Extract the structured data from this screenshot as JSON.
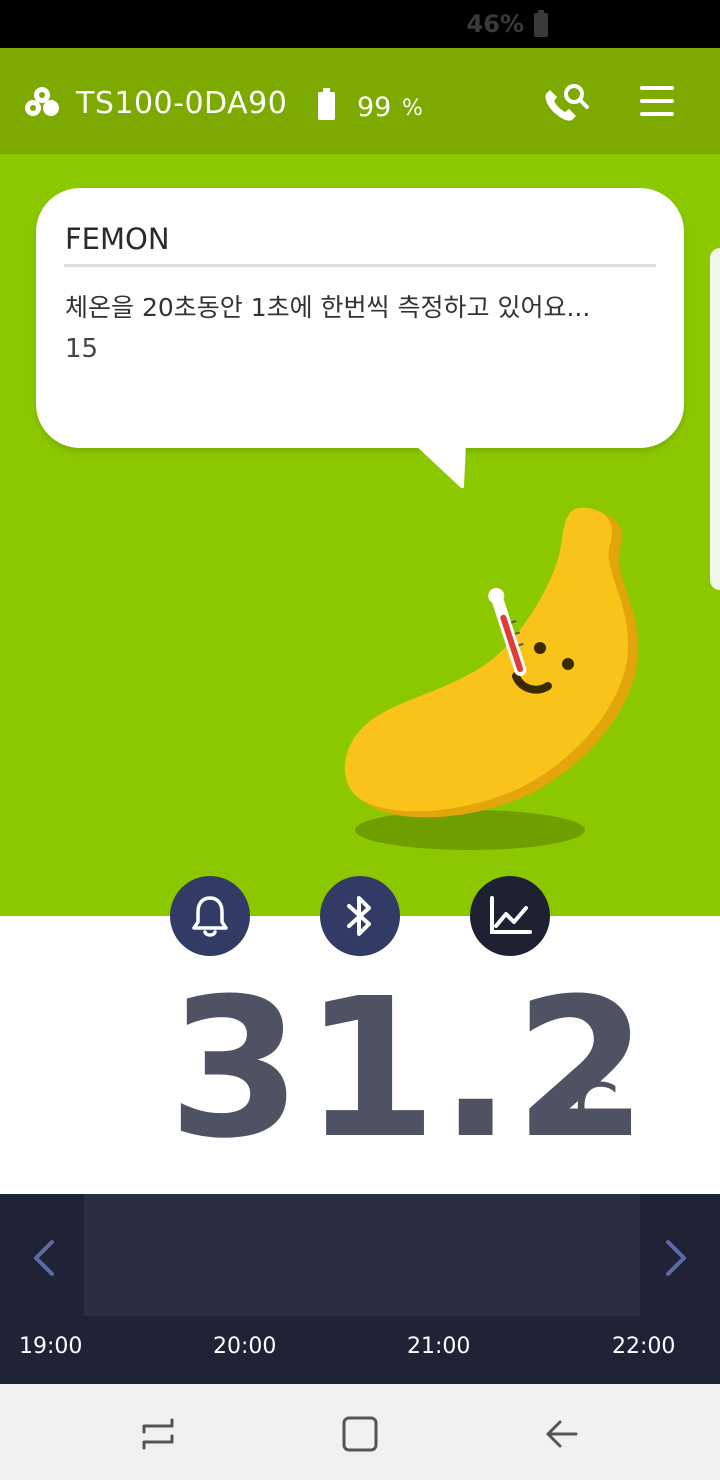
{
  "status_bar": {
    "battery_percent": "46%"
  },
  "header": {
    "device_name": "TS100-0DA90",
    "battery_value": "99",
    "battery_unit": "%",
    "icons": [
      "logo-icon",
      "battery-icon",
      "call-search-icon",
      "menu-icon"
    ]
  },
  "bubble": {
    "title": "FEMON",
    "message": "체온을 20초동안 1초에 한번씩 측정하고 있어요...",
    "count": "15"
  },
  "actions": {
    "icons": [
      "bell-icon",
      "bluetooth-icon",
      "chart-icon"
    ]
  },
  "temperature": {
    "value": "31.2",
    "unit": "℃"
  },
  "timeline": {
    "times": [
      "19:00",
      "20:00",
      "21:00",
      "22:00"
    ]
  },
  "colors": {
    "header_green": "#7daa00",
    "hero_green": "#8cc800",
    "button_navy": "#323a66",
    "button_dark": "#1d2131",
    "temp_text": "#4f5262",
    "timeline_bg": "#1f2335",
    "banana_yellow": "#f9c31a"
  }
}
